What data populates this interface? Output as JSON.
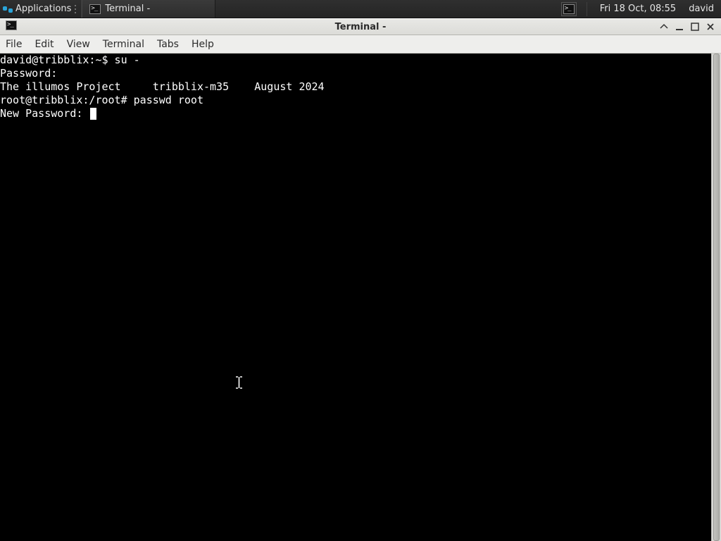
{
  "panel": {
    "applications_label": "Applications",
    "task_title": "Terminal -",
    "clock": "Fri 18 Oct, 08:55",
    "username": "david"
  },
  "window": {
    "title": "Terminal -"
  },
  "menubar": {
    "file": "File",
    "edit": "Edit",
    "view": "View",
    "terminal": "Terminal",
    "tabs": "Tabs",
    "help": "Help"
  },
  "terminal": {
    "lines": [
      "david@tribblix:~$ su -",
      "Password:",
      "The illumos Project     tribblix-m35    August 2024",
      "root@tribblix:/root# passwd root",
      "New Password: "
    ]
  }
}
